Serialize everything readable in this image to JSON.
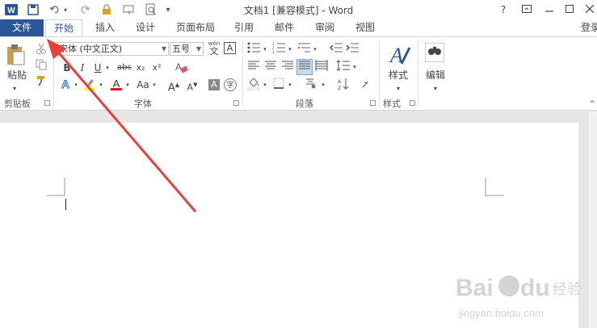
{
  "title_bar": {
    "word_icon": "W",
    "title": "文档1 [兼容模式] - Word",
    "help": "?",
    "window_controls": [
      "minimize",
      "maximize",
      "close"
    ]
  },
  "tabs": {
    "file": "文件",
    "items": [
      "开始",
      "插入",
      "设计",
      "页面布局",
      "引用",
      "邮件",
      "审阅",
      "视图"
    ],
    "sign_in": "登录"
  },
  "ribbon": {
    "clipboard": {
      "paste": "粘贴",
      "label": "剪贴板"
    },
    "font": {
      "font_name": "宋体 (中文正文)",
      "font_size": "五号",
      "wen_top": "wén",
      "wen_bottom": "文",
      "boxed": "A",
      "bold": "B",
      "italic": "I",
      "underline": "U",
      "strike": "abc",
      "sub": "x₂",
      "sup": "x²",
      "aa": "Aa",
      "grow": "A",
      "shrink": "A",
      "char_shade": "A",
      "enclose": "字",
      "label": "字体"
    },
    "paragraph": {
      "label": "段落"
    },
    "styles": {
      "button": "样式",
      "label": "样式"
    },
    "editing": {
      "button": "编辑"
    }
  },
  "watermark": {
    "text1": "Bai",
    "text2": "du",
    "text3": "经验",
    "url": "jingyan.baidu.com"
  },
  "colors": {
    "accent": "#2b579a",
    "arrow": "#e8413c",
    "highlight": "#ffff00",
    "font_color": "#e81123"
  }
}
